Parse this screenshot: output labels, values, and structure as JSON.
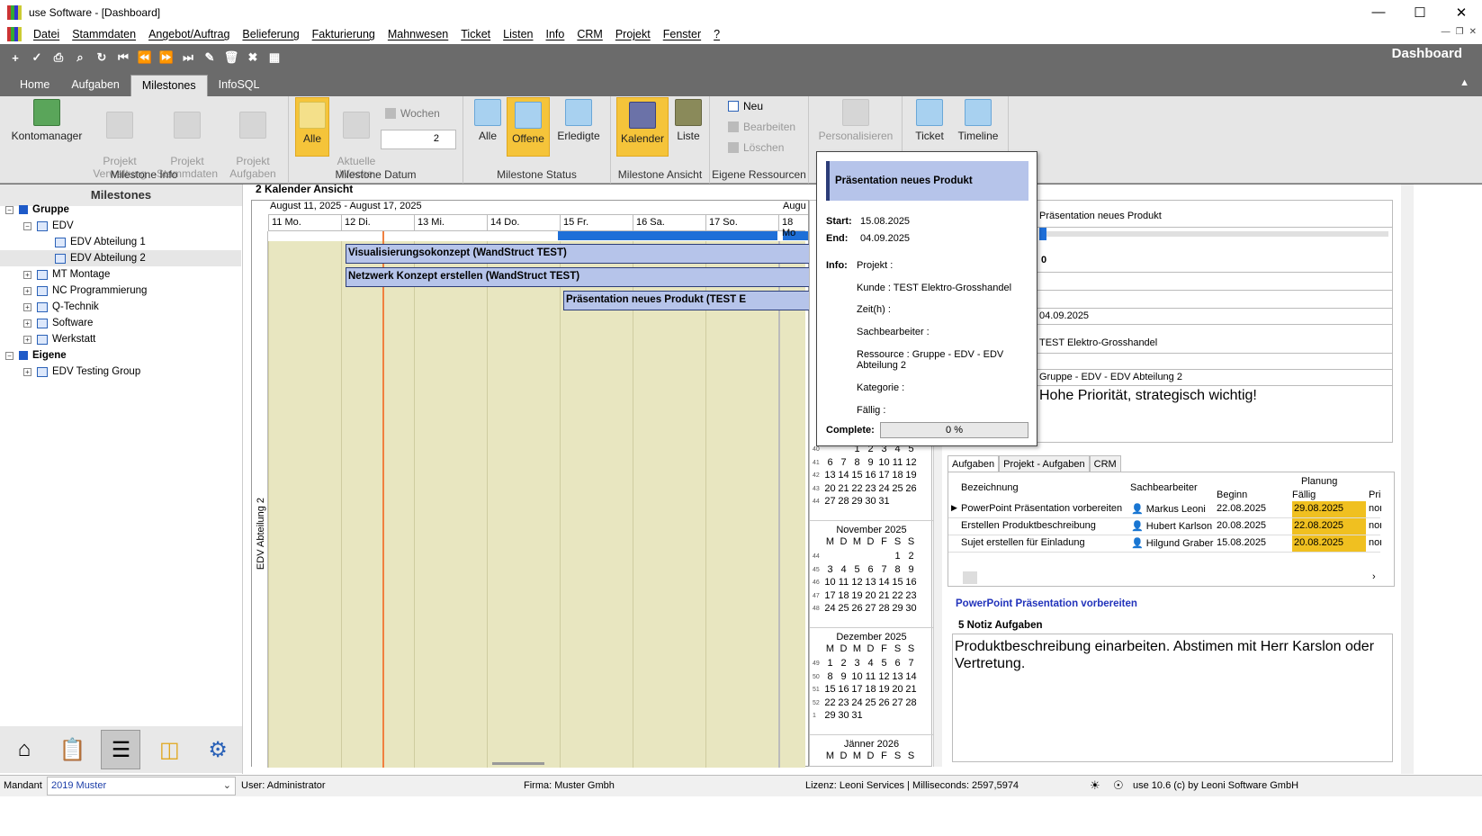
{
  "window": {
    "title": "use Software - [Dashboard]"
  },
  "menu": [
    "Datei",
    "Stammdaten",
    "Angebot/Auftrag",
    "Belieferung",
    "Fakturierung",
    "Mahnwesen",
    "Ticket",
    "Listen",
    "Info",
    "CRM",
    "Projekt",
    "Fenster",
    "?"
  ],
  "header": {
    "dashboard": "Dashboard"
  },
  "tabs": [
    "Home",
    "Aufgaben",
    "Milestones",
    "InfoSQL"
  ],
  "ribbon": {
    "milestone_info": {
      "label": "Milestone Info",
      "kontomanager": "Kontomanager",
      "projekt_verwaltung": "Projekt\nVerwaltung",
      "projekt_stammdaten": "Projekt\nStammdaten",
      "projekt_aufgaben": "Projekt\nAufgaben"
    },
    "milestone_datum": {
      "label": "Milestone Datum",
      "alle": "Alle",
      "aktuelle_woche": "Aktuelle\nWoche",
      "wochen": "Wochen",
      "wochen_value": "2"
    },
    "milestone_status": {
      "label": "Milestone Status",
      "alle": "Alle",
      "offene": "Offene",
      "erledigte": "Erledigte"
    },
    "milestone_ansicht": {
      "label": "Milestone Ansicht",
      "kalender": "Kalender",
      "liste": "Liste"
    },
    "eigene_ressourcen": {
      "label": "Eigene Ressourcen",
      "neu": "Neu",
      "bearbeiten": "Bearbeiten",
      "loeschen": "Löschen"
    },
    "personalisieren": "Personalisieren",
    "ticket": "Ticket",
    "timeline": "Timeline"
  },
  "left": {
    "title": "Milestones",
    "tree": [
      {
        "label": "Gruppe",
        "level": 0,
        "bold": true,
        "kind": "group",
        "exp": "−"
      },
      {
        "label": "EDV",
        "level": 1,
        "kind": "folder",
        "exp": "−"
      },
      {
        "label": "EDV Abteilung 1",
        "level": 2,
        "kind": "folder",
        "exp": ""
      },
      {
        "label": "EDV Abteilung 2",
        "level": 2,
        "kind": "folder",
        "exp": "",
        "selected": true
      },
      {
        "label": "MT Montage",
        "level": 1,
        "kind": "folder",
        "exp": "+"
      },
      {
        "label": "NC Programmierung",
        "level": 1,
        "kind": "folder",
        "exp": "+"
      },
      {
        "label": "Q-Technik",
        "level": 1,
        "kind": "folder",
        "exp": "+"
      },
      {
        "label": "Software",
        "level": 1,
        "kind": "folder",
        "exp": "+"
      },
      {
        "label": "Werkstatt",
        "level": 1,
        "kind": "folder",
        "exp": "+"
      },
      {
        "label": "Eigene",
        "level": 0,
        "bold": true,
        "kind": "group",
        "exp": "−"
      },
      {
        "label": "EDV Testing Group",
        "level": 1,
        "kind": "folder",
        "exp": "+"
      }
    ]
  },
  "calendar": {
    "title": "2 Kalender Ansicht",
    "range": "August 11, 2025 - August 17, 2025",
    "next_range": "Augu",
    "days": [
      "11 Mo.",
      "12 Di.",
      "13 Mi.",
      "14 Do.",
      "15 Fr.",
      "16 Sa.",
      "17 So.",
      "18 Mo"
    ],
    "resource": "EDV Abteilung 2",
    "milestones": [
      {
        "label": "Visualisierungsokonzept (WandStruct TEST)"
      },
      {
        "label": "Netzwerk Konzept erstellen (WandStruct TEST)"
      },
      {
        "label": "Präsentation neues Produkt (TEST E"
      }
    ]
  },
  "minical": {
    "weekdays": [
      "M",
      "D",
      "M",
      "D",
      "F",
      "S",
      "S"
    ],
    "oct_rows": [
      {
        "wk": "40",
        "days": [
          "",
          "",
          "1",
          "2",
          "3",
          "4",
          "5"
        ]
      },
      {
        "wk": "41",
        "days": [
          "6",
          "7",
          "8",
          "9",
          "10",
          "11",
          "12"
        ]
      },
      {
        "wk": "42",
        "days": [
          "13",
          "14",
          "15",
          "16",
          "17",
          "18",
          "19"
        ]
      },
      {
        "wk": "43",
        "days": [
          "20",
          "21",
          "22",
          "23",
          "24",
          "25",
          "26"
        ]
      },
      {
        "wk": "44",
        "days": [
          "27",
          "28",
          "29",
          "30",
          "31",
          "",
          ""
        ]
      }
    ],
    "nov_title": "November 2025",
    "nov_rows": [
      {
        "wk": "44",
        "days": [
          "",
          "",
          "",
          "",
          "",
          "1",
          "2"
        ]
      },
      {
        "wk": "45",
        "days": [
          "3",
          "4",
          "5",
          "6",
          "7",
          "8",
          "9"
        ]
      },
      {
        "wk": "46",
        "days": [
          "10",
          "11",
          "12",
          "13",
          "14",
          "15",
          "16"
        ]
      },
      {
        "wk": "47",
        "days": [
          "17",
          "18",
          "19",
          "20",
          "21",
          "22",
          "23"
        ]
      },
      {
        "wk": "48",
        "days": [
          "24",
          "25",
          "26",
          "27",
          "28",
          "29",
          "30"
        ]
      }
    ],
    "dec_title": "Dezember 2025",
    "dec_rows": [
      {
        "wk": "49",
        "days": [
          "1",
          "2",
          "3",
          "4",
          "5",
          "6",
          "7"
        ]
      },
      {
        "wk": "50",
        "days": [
          "8",
          "9",
          "10",
          "11",
          "12",
          "13",
          "14"
        ]
      },
      {
        "wk": "51",
        "days": [
          "15",
          "16",
          "17",
          "18",
          "19",
          "20",
          "21"
        ]
      },
      {
        "wk": "52",
        "days": [
          "22",
          "23",
          "24",
          "25",
          "26",
          "27",
          "28"
        ]
      },
      {
        "wk": "1",
        "days": [
          "29",
          "30",
          "31",
          "",
          "",
          "",
          ""
        ]
      }
    ],
    "jan_title": "Jänner 2026"
  },
  "popup": {
    "title": "Präsentation neues Produkt",
    "start_label": "Start:",
    "start": "15.08.2025",
    "end_label": "End:",
    "end": "04.09.2025",
    "info_label": "Info:",
    "projekt": "Projekt :",
    "kunde": "Kunde : TEST Elektro-Grosshandel",
    "zeit": "Zeit(h) :",
    "sachbearbeiter": "Sachbearbeiter :",
    "ressource": "Ressource : Gruppe - EDV - EDV Abteilung 2",
    "kategorie": "Kategorie :",
    "faellig": "Fällig :",
    "complete_label": "Complete:",
    "complete": "0 %"
  },
  "detail": {
    "title": "Präsentation neues Produkt",
    "progress": "0",
    "end": "04.09.2025",
    "customer": "TEST Elektro-Grosshandel",
    "resource": "Gruppe - EDV - EDV Abteilung 2",
    "note": "Hohe Priorität, strategisch wichtig!"
  },
  "tasks": {
    "tabs": [
      "Aufgaben",
      "Projekt - Aufgaben",
      "CRM"
    ],
    "headers": {
      "bezeichnung": "Bezeichnung",
      "sachbearbeiter": "Sachbearbeiter",
      "planung": "Planung",
      "beginn": "Beginn",
      "faellig": "Fällig",
      "prio": "Pri"
    },
    "rows": [
      {
        "name": "PowerPoint Präsentation vorbereiten",
        "person": "Markus Leoni",
        "begin": "22.08.2025",
        "due": "29.08.2025",
        "prio": "nor"
      },
      {
        "name": "Erstellen Produktbeschreibung",
        "person": "Hubert Karlson",
        "begin": "20.08.2025",
        "due": "22.08.2025",
        "prio": "nor"
      },
      {
        "name": "Sujet erstellen für Einladung",
        "person": "Hilgund Graber",
        "begin": "15.08.2025",
        "due": "20.08.2025",
        "prio": "nor"
      }
    ],
    "selected_task": "PowerPoint Präsentation vorbereiten",
    "notes_label": "5 Notiz Aufgaben",
    "note": "Produktbeschreibung einarbeiten. Abstimen mit Herr Karslon oder Vertretung."
  },
  "status": {
    "mandant_label": "Mandant",
    "mandant": "2019 Muster",
    "user": "User: Administrator",
    "firma": "Firma: Muster Gmbh",
    "lizenz": "Lizenz: Leoni Services | Milliseconds: 2597,5974",
    "version": "use 10.6 (c) by Leoni Software GmbH"
  }
}
